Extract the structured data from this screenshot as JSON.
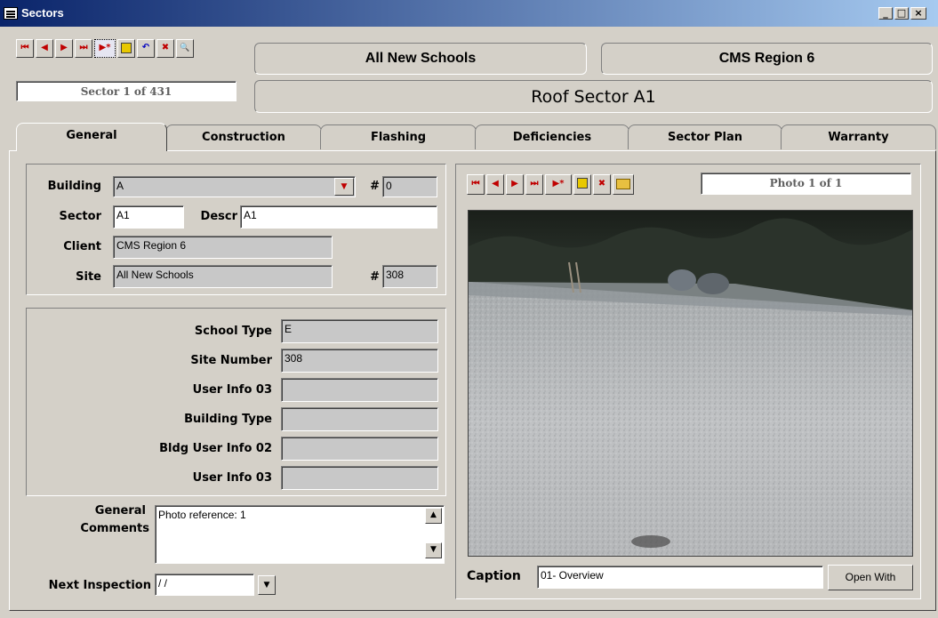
{
  "window": {
    "title": "Sectors",
    "minimize": "_",
    "maximize": "□",
    "close": "×"
  },
  "nav": {
    "first": "⏮",
    "prev": "◀",
    "next": "▶",
    "last": "⏭",
    "new": "▶*",
    "save": "save",
    "undo": "↶",
    "delete": "✖",
    "find": "🔍"
  },
  "header": {
    "site_name": "All New Schools",
    "client_name": "CMS Region 6",
    "record_counter": "Sector  1 of 431",
    "sector_title": "Roof Sector A1"
  },
  "tabs": [
    "General",
    "Construction",
    "Flashing",
    "Deficiencies",
    "Sector Plan",
    "Warranty"
  ],
  "general": {
    "building_label": "Building",
    "building_value": "A",
    "building_num_label": "#",
    "building_num_value": "0",
    "sector_label": "Sector",
    "sector_value": "A1",
    "descr_label": "Descr",
    "descr_value": "A1",
    "client_label": "Client",
    "client_value": "CMS Region 6",
    "site_label": "Site",
    "site_value": "All New Schools",
    "site_num_label": "#",
    "site_num_value": "308"
  },
  "info": [
    {
      "label": "School Type",
      "value": "E"
    },
    {
      "label": "Site Number",
      "value": "308"
    },
    {
      "label": "User Info 03",
      "value": ""
    },
    {
      "label": "Building Type",
      "value": ""
    },
    {
      "label": "Bldg User Info 02",
      "value": ""
    },
    {
      "label": "User Info 03",
      "value": ""
    }
  ],
  "comments": {
    "label_line1": "General",
    "label_line2": "Comments",
    "value": "Photo reference:  1"
  },
  "next_inspection": {
    "label": "Next Inspection",
    "value": " / /"
  },
  "photo": {
    "counter": "Photo  1 of 1",
    "caption_label": "Caption",
    "caption_value": "01- Overview",
    "open_with_label": "Open With"
  },
  "colors": {
    "window_bg": "#d4d0c8",
    "title_bar_start": "#0a246a",
    "title_bar_end": "#a6caf0",
    "nav_arrow": "#c00000"
  }
}
